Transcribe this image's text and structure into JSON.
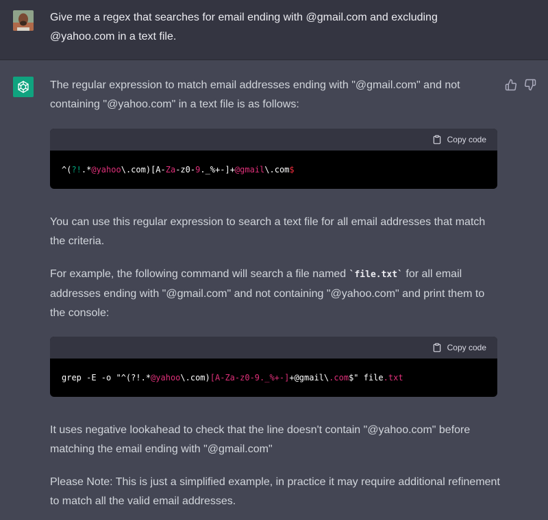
{
  "user_message": {
    "text": "Give me a regex that searches for email ending with @gmail.com and excluding @yahoo.com in a text file."
  },
  "assistant_message": {
    "intro": "The regular expression to match email addresses ending with \"@gmail.com\" and not containing \"@yahoo.com\" in a text file is as follows:",
    "code_block_1": {
      "copy_label": "Copy code",
      "tokens": [
        {
          "text": "^(",
          "color": "#ffffff"
        },
        {
          "text": "?!",
          "color": "#00a67d"
        },
        {
          "text": ".*",
          "color": "#ffffff"
        },
        {
          "text": "@yahoo",
          "color": "#df3079"
        },
        {
          "text": "\\.com)[A-",
          "color": "#ffffff"
        },
        {
          "text": "Za",
          "color": "#df3079"
        },
        {
          "text": "-z0-",
          "color": "#ffffff"
        },
        {
          "text": "9",
          "color": "#df3079"
        },
        {
          "text": "._%+-]+",
          "color": "#ffffff"
        },
        {
          "text": "@gmail",
          "color": "#df3079"
        },
        {
          "text": "\\.com",
          "color": "#ffffff"
        },
        {
          "text": "$",
          "color": "#f22c3d"
        }
      ]
    },
    "para_2": "You can use this regular expression to search a text file for all email addresses that match the criteria.",
    "para_3_before": "For example, the following command will search a file named ",
    "para_3_code": "`file.txt`",
    "para_3_after": " for all email addresses ending with \"@gmail.com\" and not containing \"@yahoo.com\" and print them to the console:",
    "code_block_2": {
      "copy_label": "Copy code",
      "tokens": [
        {
          "text": "grep -E -o \"^(?!.*",
          "color": "#ffffff"
        },
        {
          "text": "@yahoo",
          "color": "#df3079"
        },
        {
          "text": "\\.com)",
          "color": "#ffffff"
        },
        {
          "text": "[A-Za-z0-9._%+-]",
          "color": "#df3079"
        },
        {
          "text": "+@gmail\\",
          "color": "#ffffff"
        },
        {
          "text": ".com",
          "color": "#df3079"
        },
        {
          "text": "$\" file",
          "color": "#ffffff"
        },
        {
          "text": ".txt",
          "color": "#df3079"
        }
      ]
    },
    "para_4": "It uses negative lookahead to check that the line doesn't contain \"@yahoo.com\" before matching the email ending with \"@gmail.com\"",
    "para_5": "Please Note: This is just a simplified example, in practice it may require additional refinement to match all the valid email addresses."
  },
  "colors": {
    "page_bg": "#444654",
    "user_bg": "#343541",
    "assistant_avatar_bg": "#10a37f",
    "code_bg": "#000000",
    "code_header_bg": "#343541"
  },
  "icons": [
    "user-avatar",
    "openai-logo-icon",
    "thumbs-up-icon",
    "thumbs-down-icon",
    "clipboard-icon"
  ]
}
